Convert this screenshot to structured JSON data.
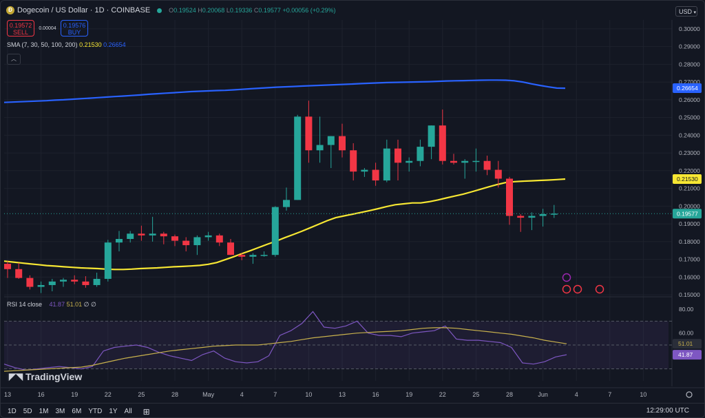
{
  "header": {
    "symbol_title": "Dogecoin / US Dollar · 1D · COINBASE",
    "ohlc": [
      {
        "k": "O",
        "v": "0.19524"
      },
      {
        "k": "H",
        "v": "0.20068"
      },
      {
        "k": "L",
        "v": "0.19336"
      },
      {
        "k": "C",
        "v": "0.19577"
      }
    ],
    "change": "+0.00056 (+0.29%)",
    "sell_price": "0.19572",
    "sell_label": "SELL",
    "spread": "0.00004",
    "buy_price": "0.19576",
    "buy_label": "BUY",
    "sma_label": "SMA (7, 30, 50, 100, 200)",
    "sma_v1": "0.21530",
    "sma_v2": "0.26654",
    "rsi_label": "RSI 14 close",
    "rsi_v1": "41.87",
    "rsi_v2": "51.01",
    "rsi_extra": "∅ ∅",
    "currency": "USD",
    "brand": "TradingView"
  },
  "timeframes": [
    "1D",
    "5D",
    "1M",
    "3M",
    "6M",
    "YTD",
    "1Y",
    "All"
  ],
  "clock": "12:29:00 UTC",
  "colors": {
    "up": "#26a69a",
    "down": "#f23645",
    "sma_short": "#f7e733",
    "sma_long": "#2962ff",
    "rsi": "#7e57c2",
    "rsi_ma": "#c9b24d",
    "bg": "#131722"
  },
  "chart_data": {
    "type": "candlestick",
    "price_ylim": [
      0.145,
      0.305
    ],
    "price_ticks": [
      "0.30000",
      "0.29000",
      "0.28000",
      "0.27000",
      "0.26000",
      "0.25000",
      "0.24000",
      "0.23000",
      "0.22000",
      "0.21000",
      "0.20000",
      "0.19000",
      "0.18000",
      "0.17000",
      "0.16000",
      "0.15000"
    ],
    "x_ticks": [
      {
        "i": 0,
        "label": "13"
      },
      {
        "i": 3,
        "label": "16"
      },
      {
        "i": 6,
        "label": "19"
      },
      {
        "i": 9,
        "label": "22"
      },
      {
        "i": 12,
        "label": "25"
      },
      {
        "i": 15,
        "label": "28"
      },
      {
        "i": 18,
        "label": "May"
      },
      {
        "i": 21,
        "label": "4"
      },
      {
        "i": 24,
        "label": "7"
      },
      {
        "i": 27,
        "label": "10"
      },
      {
        "i": 30,
        "label": "13"
      },
      {
        "i": 33,
        "label": "16"
      },
      {
        "i": 36,
        "label": "19"
      },
      {
        "i": 39,
        "label": "22"
      },
      {
        "i": 42,
        "label": "25"
      },
      {
        "i": 45,
        "label": "28"
      },
      {
        "i": 48,
        "label": "Jun"
      },
      {
        "i": 51,
        "label": "4"
      },
      {
        "i": 54,
        "label": "7"
      },
      {
        "i": 57,
        "label": "10"
      }
    ],
    "candles": [
      {
        "o": 0.1675,
        "h": 0.169,
        "l": 0.1595,
        "c": 0.1645
      },
      {
        "o": 0.1645,
        "h": 0.168,
        "l": 0.159,
        "c": 0.1595
      },
      {
        "o": 0.1595,
        "h": 0.161,
        "l": 0.153,
        "c": 0.1545
      },
      {
        "o": 0.1545,
        "h": 0.1575,
        "l": 0.151,
        "c": 0.1555
      },
      {
        "o": 0.1555,
        "h": 0.159,
        "l": 0.152,
        "c": 0.1575
      },
      {
        "o": 0.1575,
        "h": 0.1595,
        "l": 0.1545,
        "c": 0.1585
      },
      {
        "o": 0.1585,
        "h": 0.161,
        "l": 0.156,
        "c": 0.1575
      },
      {
        "o": 0.1575,
        "h": 0.1605,
        "l": 0.154,
        "c": 0.1555
      },
      {
        "o": 0.1555,
        "h": 0.1625,
        "l": 0.1545,
        "c": 0.159
      },
      {
        "o": 0.159,
        "h": 0.181,
        "l": 0.1575,
        "c": 0.1795
      },
      {
        "o": 0.1795,
        "h": 0.186,
        "l": 0.1745,
        "c": 0.1815
      },
      {
        "o": 0.1815,
        "h": 0.186,
        "l": 0.1795,
        "c": 0.1845
      },
      {
        "o": 0.1845,
        "h": 0.189,
        "l": 0.1805,
        "c": 0.1835
      },
      {
        "o": 0.1835,
        "h": 0.194,
        "l": 0.18,
        "c": 0.1845
      },
      {
        "o": 0.1845,
        "h": 0.1855,
        "l": 0.1785,
        "c": 0.183
      },
      {
        "o": 0.183,
        "h": 0.184,
        "l": 0.1775,
        "c": 0.1805
      },
      {
        "o": 0.1805,
        "h": 0.1825,
        "l": 0.1745,
        "c": 0.178
      },
      {
        "o": 0.178,
        "h": 0.1835,
        "l": 0.1725,
        "c": 0.1825
      },
      {
        "o": 0.1825,
        "h": 0.1855,
        "l": 0.1805,
        "c": 0.1835
      },
      {
        "o": 0.1835,
        "h": 0.1845,
        "l": 0.1775,
        "c": 0.1795
      },
      {
        "o": 0.1795,
        "h": 0.1815,
        "l": 0.1725,
        "c": 0.1725
      },
      {
        "o": 0.1725,
        "h": 0.1735,
        "l": 0.1695,
        "c": 0.1715
      },
      {
        "o": 0.1715,
        "h": 0.1735,
        "l": 0.1675,
        "c": 0.1725
      },
      {
        "o": 0.1725,
        "h": 0.1745,
        "l": 0.1715,
        "c": 0.1725
      },
      {
        "o": 0.1725,
        "h": 0.2,
        "l": 0.1715,
        "c": 0.1995
      },
      {
        "o": 0.1995,
        "h": 0.2105,
        "l": 0.1975,
        "c": 0.2035
      },
      {
        "o": 0.2035,
        "h": 0.2515,
        "l": 0.2035,
        "c": 0.2505
      },
      {
        "o": 0.2505,
        "h": 0.2595,
        "l": 0.2245,
        "c": 0.2315
      },
      {
        "o": 0.2315,
        "h": 0.2505,
        "l": 0.2245,
        "c": 0.2345
      },
      {
        "o": 0.2345,
        "h": 0.2395,
        "l": 0.2215,
        "c": 0.2395
      },
      {
        "o": 0.2395,
        "h": 0.2465,
        "l": 0.2275,
        "c": 0.2315
      },
      {
        "o": 0.2315,
        "h": 0.2355,
        "l": 0.2145,
        "c": 0.2195
      },
      {
        "o": 0.2195,
        "h": 0.2215,
        "l": 0.2165,
        "c": 0.2205
      },
      {
        "o": 0.2205,
        "h": 0.2245,
        "l": 0.2115,
        "c": 0.2145
      },
      {
        "o": 0.2145,
        "h": 0.2375,
        "l": 0.2135,
        "c": 0.2325
      },
      {
        "o": 0.2325,
        "h": 0.2375,
        "l": 0.2145,
        "c": 0.2245
      },
      {
        "o": 0.2245,
        "h": 0.2275,
        "l": 0.2195,
        "c": 0.2255
      },
      {
        "o": 0.2255,
        "h": 0.2375,
        "l": 0.2225,
        "c": 0.2335
      },
      {
        "o": 0.2335,
        "h": 0.2455,
        "l": 0.2265,
        "c": 0.2455
      },
      {
        "o": 0.2455,
        "h": 0.2545,
        "l": 0.2235,
        "c": 0.2255
      },
      {
        "o": 0.2255,
        "h": 0.2295,
        "l": 0.2235,
        "c": 0.2245
      },
      {
        "o": 0.2245,
        "h": 0.2265,
        "l": 0.2155,
        "c": 0.2255
      },
      {
        "o": 0.2255,
        "h": 0.2325,
        "l": 0.2195,
        "c": 0.2255
      },
      {
        "o": 0.2255,
        "h": 0.2285,
        "l": 0.2175,
        "c": 0.2205
      },
      {
        "o": 0.2205,
        "h": 0.2255,
        "l": 0.2105,
        "c": 0.2155
      },
      {
        "o": 0.2155,
        "h": 0.2165,
        "l": 0.1895,
        "c": 0.1945
      },
      {
        "o": 0.1945,
        "h": 0.1955,
        "l": 0.1855,
        "c": 0.1935
      },
      {
        "o": 0.1935,
        "h": 0.1965,
        "l": 0.1865,
        "c": 0.1945
      },
      {
        "o": 0.1945,
        "h": 0.1985,
        "l": 0.1885,
        "c": 0.1955
      },
      {
        "o": 0.19524,
        "h": 0.20068,
        "l": 0.19336,
        "c": 0.19577
      }
    ],
    "series": [
      {
        "name": "SMA 50",
        "values": [
          0.169,
          0.1685,
          0.168,
          0.1675,
          0.167,
          0.1665,
          0.1662,
          0.1658,
          0.1655,
          0.1652,
          0.165,
          0.1648,
          0.1645,
          0.1643,
          0.1643,
          0.1645,
          0.1648,
          0.165,
          0.1652,
          0.1655,
          0.1658,
          0.166,
          0.1663,
          0.1666,
          0.1672,
          0.1682,
          0.1698,
          0.1715,
          0.1733,
          0.175,
          0.1768,
          0.1786,
          0.1803,
          0.1822,
          0.184,
          0.1858,
          0.1878,
          0.1898,
          0.1918,
          0.1935,
          0.1945,
          0.1955,
          0.1965,
          0.1975,
          0.1986,
          0.1998,
          0.2008,
          0.2013,
          0.2018,
          0.2018,
          0.2025,
          0.2035,
          0.2046,
          0.2057,
          0.2068,
          0.2081,
          0.2095,
          0.2109,
          0.2122,
          0.2133,
          0.2138,
          0.2141,
          0.2143,
          0.2145,
          0.2147,
          0.215,
          0.2153
        ]
      },
      {
        "name": "SMA 200",
        "values": [
          0.2585,
          0.2587,
          0.2589,
          0.2591,
          0.2593,
          0.2595,
          0.2598,
          0.26,
          0.2603,
          0.2606,
          0.2609,
          0.2612,
          0.2615,
          0.2618,
          0.2621,
          0.2624,
          0.2627,
          0.2631,
          0.2634,
          0.2637,
          0.264,
          0.2643,
          0.2646,
          0.2648,
          0.265,
          0.2652,
          0.2653,
          0.2656,
          0.2659,
          0.2662,
          0.2665,
          0.2668,
          0.2671,
          0.2673,
          0.2675,
          0.2677,
          0.2679,
          0.2681,
          0.2683,
          0.2685,
          0.2687,
          0.2689,
          0.2691,
          0.2693,
          0.2695,
          0.2697,
          0.2698,
          0.2699,
          0.27,
          0.2701,
          0.2702,
          0.2704,
          0.2706,
          0.2707,
          0.2708,
          0.2709,
          0.271,
          0.2711,
          0.2711,
          0.271,
          0.2707,
          0.27,
          0.269,
          0.2681,
          0.2673,
          0.2666,
          0.2665
        ]
      }
    ],
    "rsi": {
      "ylim": [
        20,
        80
      ],
      "ticks": [
        "80.00",
        "60.00"
      ],
      "upper": 70,
      "lower": 30,
      "rsi_values": [
        34,
        31,
        29,
        30,
        31,
        32,
        31,
        30,
        32,
        45,
        48,
        49,
        50,
        48,
        44,
        41,
        39,
        37,
        42,
        45,
        39,
        36,
        35,
        36,
        41,
        58,
        62,
        68,
        78,
        65,
        64,
        66,
        70,
        60,
        58,
        58,
        57,
        60,
        61,
        62,
        66,
        55,
        54,
        54,
        53,
        52,
        48,
        35,
        34,
        36,
        40,
        41.87
      ],
      "ma_values": [
        28,
        28.5,
        29,
        29.5,
        30,
        30.5,
        31,
        31.5,
        33,
        35,
        37,
        39,
        40.5,
        42,
        43.5,
        45,
        46,
        47,
        48,
        49,
        49.5,
        50,
        50,
        50,
        51,
        52,
        53,
        54.5,
        56,
        57,
        58,
        59,
        60,
        60.5,
        61,
        61.5,
        62,
        63,
        64,
        64.5,
        64.5,
        64,
        63,
        62,
        61,
        60,
        59,
        57.5,
        56,
        54,
        52.5,
        51.01
      ]
    }
  }
}
